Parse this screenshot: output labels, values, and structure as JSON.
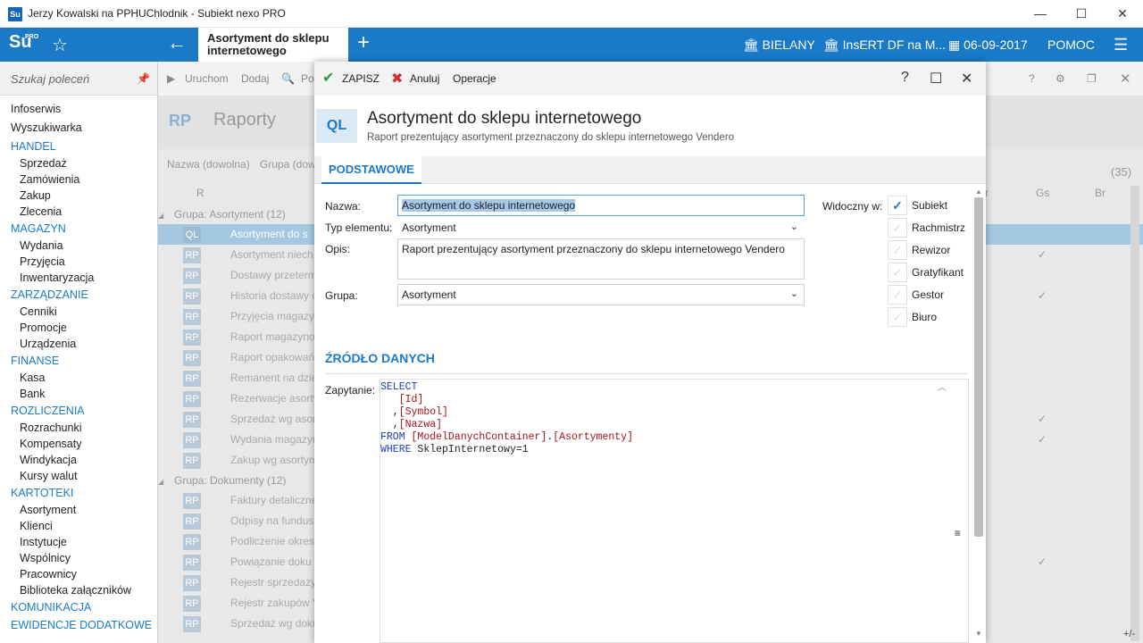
{
  "window": {
    "title": "Jerzy Kowalski na PPHUChlodnik - Subiekt nexo PRO",
    "app_icon_text": "Su",
    "minimize": "—",
    "maximize": "☐",
    "close": "✕"
  },
  "topbar": {
    "logo": "Su",
    "logo_sup": "PRO",
    "active_tab": "Asortyment do sklepu internetowego",
    "location": "BIELANY",
    "company": "InsERT DF na M...",
    "date": "06-09-2017",
    "help": "POMOC"
  },
  "sidebar": {
    "search_placeholder": "Szukaj poleceń",
    "items": [
      {
        "type": "top",
        "label": "Infoserwis"
      },
      {
        "type": "top",
        "label": "Wyszukiwarka"
      },
      {
        "type": "sec",
        "label": "HANDEL"
      },
      {
        "type": "sub",
        "label": "Sprzedaż"
      },
      {
        "type": "sub",
        "label": "Zamówienia"
      },
      {
        "type": "sub",
        "label": "Zakup"
      },
      {
        "type": "sub",
        "label": "Zlecenia"
      },
      {
        "type": "sec",
        "label": "MAGAZYN"
      },
      {
        "type": "sub",
        "label": "Wydania"
      },
      {
        "type": "sub",
        "label": "Przyjęcia"
      },
      {
        "type": "sub",
        "label": "Inwentaryzacja"
      },
      {
        "type": "sec",
        "label": "ZARZĄDZANIE"
      },
      {
        "type": "sub",
        "label": "Cenniki"
      },
      {
        "type": "sub",
        "label": "Promocje"
      },
      {
        "type": "sub",
        "label": "Urządzenia"
      },
      {
        "type": "sec",
        "label": "FINANSE"
      },
      {
        "type": "sub",
        "label": "Kasa"
      },
      {
        "type": "sub",
        "label": "Bank"
      },
      {
        "type": "sec",
        "label": "ROZLICZENIA"
      },
      {
        "type": "sub",
        "label": "Rozrachunki"
      },
      {
        "type": "sub",
        "label": "Kompensaty"
      },
      {
        "type": "sub",
        "label": "Windykacja"
      },
      {
        "type": "sub",
        "label": "Kursy walut"
      },
      {
        "type": "sec",
        "label": "KARTOTEKI"
      },
      {
        "type": "sub",
        "label": "Asortyment"
      },
      {
        "type": "sub",
        "label": "Klienci"
      },
      {
        "type": "sub",
        "label": "Instytucje"
      },
      {
        "type": "sub",
        "label": "Wspólnicy"
      },
      {
        "type": "sub",
        "label": "Pracownicy"
      },
      {
        "type": "sub",
        "label": "Biblioteka załączników"
      },
      {
        "type": "sec",
        "label": "KOMUNIKACJA"
      },
      {
        "type": "sec",
        "label": "EWIDENCJE DODATKOWE"
      }
    ]
  },
  "background": {
    "toolbar": [
      "Uruchom",
      "Dodaj",
      "Po"
    ],
    "badge": "RP",
    "title": "Raporty",
    "filter_name": "Nazwa (dowolna)",
    "filter_group": "Grupa (dow",
    "count": "(35)",
    "col_r": "R",
    "col_gs": "Gs",
    "col_br": "Br",
    "col_r2": "r",
    "rows": [
      {
        "kind": "grp",
        "text": "Grupa: Asortyment (12)"
      },
      {
        "kind": "sel",
        "badge": "QL",
        "text": "Asortyment do s"
      },
      {
        "kind": "row",
        "badge": "RP",
        "text": "Asortyment niech",
        "check": "✓"
      },
      {
        "kind": "row",
        "badge": "RP",
        "text": "Dostawy przeterm"
      },
      {
        "kind": "row",
        "badge": "RP",
        "text": "Historia dostawy c",
        "check": "✓"
      },
      {
        "kind": "row",
        "badge": "RP",
        "text": "Przyjęcia magazyn"
      },
      {
        "kind": "row",
        "badge": "RP",
        "text": "Raport magazyno"
      },
      {
        "kind": "row",
        "badge": "RP",
        "text": "Raport opakowań"
      },
      {
        "kind": "row",
        "badge": "RP",
        "text": "Remanent na dzie"
      },
      {
        "kind": "row",
        "badge": "RP",
        "text": "Rezerwacje asorty"
      },
      {
        "kind": "row",
        "badge": "RP",
        "text": "Sprzedaż wg asort",
        "check": "✓"
      },
      {
        "kind": "row",
        "badge": "RP",
        "text": "Wydania magazyn",
        "check": "✓"
      },
      {
        "kind": "row",
        "badge": "RP",
        "text": "Zakup wg asortym"
      },
      {
        "kind": "grp",
        "text": "Grupa: Dokumenty (12)"
      },
      {
        "kind": "row",
        "badge": "RP",
        "text": "Faktury detaliczne"
      },
      {
        "kind": "row",
        "badge": "RP",
        "text": "Odpisy na fundus"
      },
      {
        "kind": "row",
        "badge": "RP",
        "text": "Podliczenie okresu"
      },
      {
        "kind": "row",
        "badge": "RP",
        "text": "Powiązanie doku",
        "check": "✓"
      },
      {
        "kind": "row",
        "badge": "RP",
        "text": "Rejestr sprzedaży V"
      },
      {
        "kind": "row",
        "badge": "RP",
        "text": "Rejestr zakupów V"
      },
      {
        "kind": "row",
        "badge": "RP",
        "text": "Sprzedaż wg doku"
      }
    ],
    "corner": "+/-"
  },
  "dialog": {
    "save": "ZAPISZ",
    "cancel": "Anuluj",
    "operations": "Operacje",
    "help_icon": "?",
    "badge": "QL",
    "title": "Asortyment do sklepu internetowego",
    "subtitle": "Raport prezentujący asortyment przeznaczony do sklepu internetowego Vendero",
    "tab": "PODSTAWOWE",
    "name_label": "Nazwa:",
    "name_value": "Asortyment do sklepu internetowego",
    "type_label": "Typ elementu:",
    "type_value": "Asortyment",
    "desc_label": "Opis:",
    "desc_value": "Raport prezentujący asortyment przeznaczony do sklepu internetowego Vendero",
    "group_label": "Grupa:",
    "group_value": "Asortyment",
    "visible_label": "Widoczny w:",
    "visible": [
      {
        "label": "Subiekt",
        "checked": true
      },
      {
        "label": "Rachmistrz",
        "checked": false
      },
      {
        "label": "Rewizor",
        "checked": false
      },
      {
        "label": "Gratyfikant",
        "checked": false
      },
      {
        "label": "Gestor",
        "checked": false
      },
      {
        "label": "Biuro",
        "checked": false
      }
    ],
    "source_header": "ŹRÓDŁO DANYCH",
    "query_label": "Zapytanie:",
    "query_lines": [
      [
        {
          "c": "kw",
          "t": "SELECT"
        }
      ],
      [
        {
          "c": "tx",
          "t": "   "
        },
        {
          "c": "br",
          "t": "[Id]"
        }
      ],
      [
        {
          "c": "tx",
          "t": "  ,"
        },
        {
          "c": "br",
          "t": "[Symbol]"
        }
      ],
      [
        {
          "c": "tx",
          "t": "  ,"
        },
        {
          "c": "br",
          "t": "[Nazwa]"
        }
      ],
      [
        {
          "c": "kw",
          "t": "FROM "
        },
        {
          "c": "br",
          "t": "[ModelDanychContainer]"
        },
        {
          "c": "tx",
          "t": "."
        },
        {
          "c": "br",
          "t": "[Asortymenty]"
        }
      ],
      [
        {
          "c": "kw",
          "t": "WHERE "
        },
        {
          "c": "tx",
          "t": "SklepInternetowy=1"
        }
      ]
    ]
  }
}
